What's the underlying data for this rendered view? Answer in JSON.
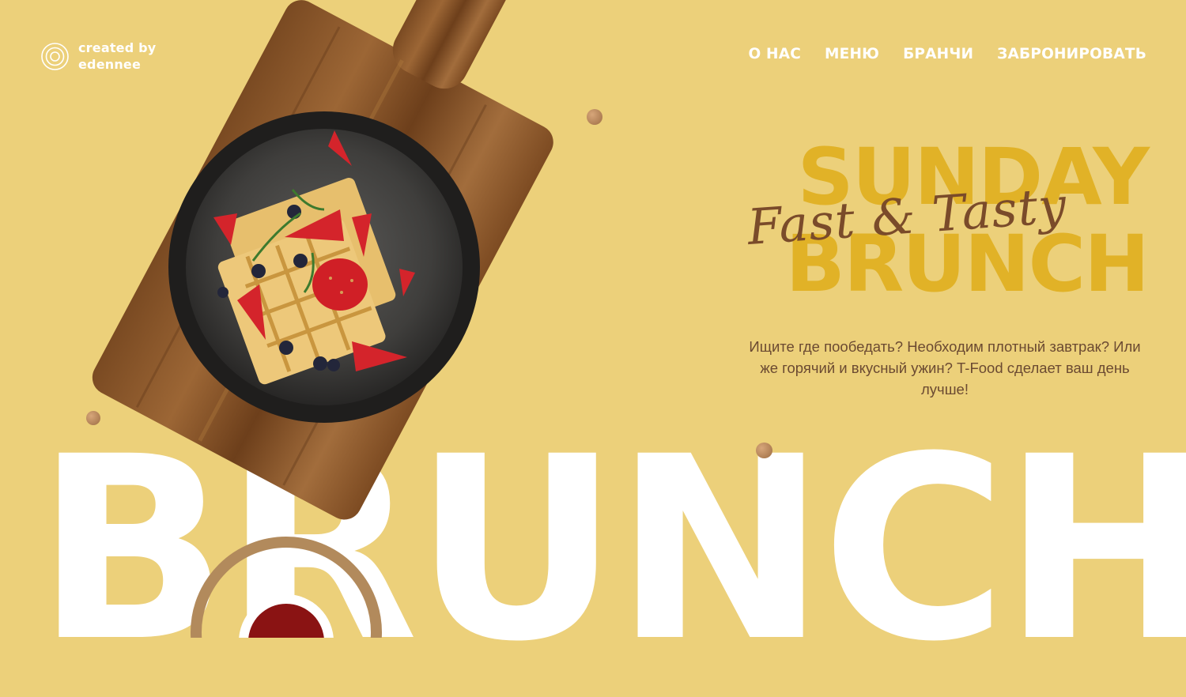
{
  "logo": {
    "line1": "created by",
    "line2": "edennee",
    "icon": "circle-logo-icon"
  },
  "nav": {
    "about": "О НАС",
    "menu": "МЕНЮ",
    "brunches": "БРАНЧИ",
    "book": "ЗАБРОНИРОВАТЬ"
  },
  "hero": {
    "word1": "SUNDAY",
    "word2": "BRUNCH",
    "script": "Fast & Tasty",
    "description": "Ищите где пообедать? Необходим плотный завтрак? Или же горячий и вкусный ужин? T-Food сделает ваш день лучше!"
  },
  "background_word": "BRUNCH",
  "colors": {
    "background": "#ecd07a",
    "accent_yellow": "#e1b227",
    "script_brown": "#7a4b2a",
    "text_brown": "#6b4a32",
    "white": "#ffffff"
  }
}
